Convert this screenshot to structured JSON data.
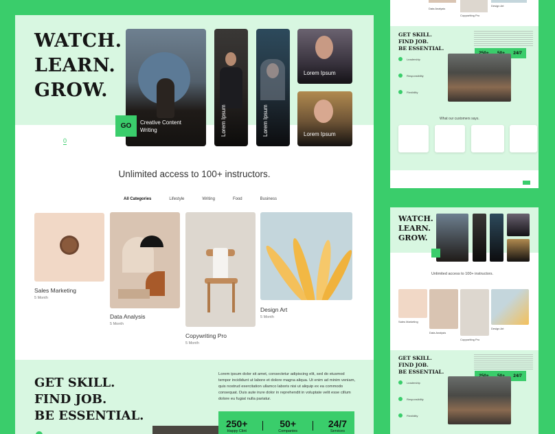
{
  "hero": {
    "title_line1": "WATCH.",
    "title_line2": "LEARN.",
    "title_line3": "GROW.",
    "go_label": "GO",
    "go_text": "Creative Content Writing",
    "card_label": "Lorem Ipsum",
    "pager_label": "0"
  },
  "instructors": {
    "title": "Unlimited access to 100+ instructors.",
    "categories": [
      "All Categories",
      "Lifestyle",
      "Writing",
      "Food",
      "Business"
    ]
  },
  "courses": [
    {
      "name": "Sales Marketing",
      "duration": "5 Month"
    },
    {
      "name": "Data Analysis",
      "duration": "5 Month"
    },
    {
      "name": "Copywriting Pro",
      "duration": "5 Month"
    },
    {
      "name": "Design Art",
      "duration": "5 Month"
    }
  ],
  "skill": {
    "title_line1": "GET SKILL.",
    "title_line2": "FIND JOB.",
    "title_line3": "BE ESSENTIAL.",
    "description": "Lorem ipsum dolor sit amet, consectetur adipiscing elit, sed do eiusmod tempor incididunt ut labore et dolore magna aliqua. Ut enim ad minim veniam, quis nostrud exercitation ullamco laboris nisi ut aliquip ex ea commodo consequat. Duis aute irure dolor in reprehendit in voluptate velit esse cillum dolore eu fugiat nulla pariatur.",
    "stats": [
      {
        "value": "250+",
        "label": "Happy Clint"
      },
      {
        "value": "50+",
        "label": "Companies"
      },
      {
        "value": "24/7",
        "label": "Services"
      }
    ],
    "features": [
      "Leadership",
      "Responsibility",
      "Flexibility"
    ]
  },
  "customers": {
    "title": "What our customers says."
  },
  "colors": {
    "brand_green": "#3acd6b",
    "light_green": "#d8f7e1",
    "dark_text": "#151515"
  }
}
